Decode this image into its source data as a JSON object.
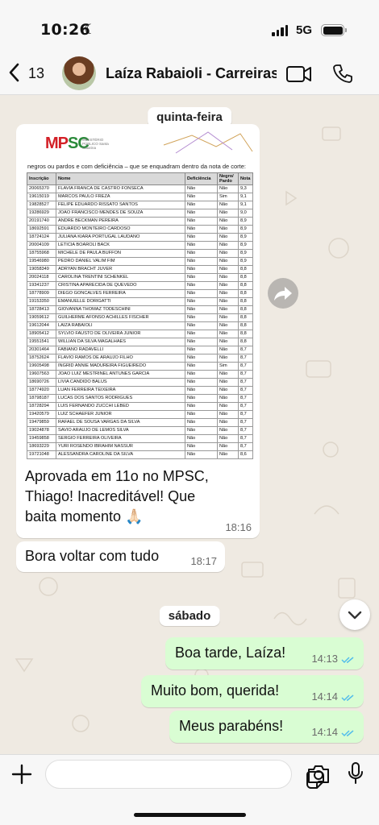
{
  "status_bar": {
    "time": "10:26",
    "network": "5G"
  },
  "header": {
    "back_count": "13",
    "contact_name": "Laíza Rabaioli - Carreiras...",
    "icons": [
      "back-arrow-icon",
      "avatar",
      "video-call-icon",
      "phone-icon"
    ]
  },
  "chat": {
    "day_thursday": "quinta-feira",
    "document": {
      "logo_mp": "MP",
      "logo_sc": "SC",
      "logo_sub": "MINISTÉRIO PÚBLICO Santa Catarina",
      "intro": "negros ou pardos e com deficiência – que se enquadram dentro da nota de corte:",
      "columns": [
        "Inscrição",
        "Nome",
        "Deficiência",
        "Negro/ Pardo",
        "Nota"
      ],
      "rows": [
        [
          "20065370",
          "FLAVIA FRANCA DE CASTRO FONSECA",
          "Não",
          "Não",
          "9,3"
        ],
        [
          "19615019",
          "MARCOS PAULO FREZA",
          "Não",
          "Sim",
          "9,1"
        ],
        [
          "19828527",
          "FELIPE EDUARDO RISSATO SANTOS",
          "Não",
          "Não",
          "9,1"
        ],
        [
          "19286929",
          "JOAO FRANCISCO MENDES DE SOUZA",
          "Não",
          "Não",
          "9,0"
        ],
        [
          "20191740",
          "ANDRE BECKMAN PEREIRA",
          "Não",
          "Não",
          "8,9"
        ],
        [
          "18692591",
          "EDUARDO MONTEIRO CARDOSO",
          "Não",
          "Não",
          "8,9"
        ],
        [
          "18724124",
          "JULIANA KIARA PORTUGAL LAUDANO",
          "Não",
          "Não",
          "8,9"
        ],
        [
          "20004109",
          "LETICIA BOAROLI BACK",
          "Não",
          "Não",
          "8,9"
        ],
        [
          "18755968",
          "MICHELE DE PAULA BUFFON",
          "Não",
          "Não",
          "8,9"
        ],
        [
          "19546980",
          "PEDRO DANIEL VALIM FIM",
          "Não",
          "Não",
          "8,9"
        ],
        [
          "19058349",
          "ADRYAN BRACHT JUVER",
          "Não",
          "Não",
          "8,8"
        ],
        [
          "20024118",
          "CAROLINA TRENTINI SCHENKEL",
          "Não",
          "Não",
          "8,8"
        ],
        [
          "19341237",
          "CRISTINA APARECIDA DE QUEVEDO",
          "Não",
          "Não",
          "8,8"
        ],
        [
          "18778909",
          "DIEGO GONCALVES FERREIRA",
          "Não",
          "Não",
          "8,8"
        ],
        [
          "19153350",
          "EMANUELLE DORIGATTI",
          "Não",
          "Não",
          "8,8"
        ],
        [
          "18728413",
          "GIOVANNA THOMAZ TODESCHINI",
          "Não",
          "Não",
          "8,8"
        ],
        [
          "19059612",
          "GUILHERME AFONSO ACHILLES FISCHER",
          "Não",
          "Não",
          "8,8"
        ],
        [
          "19612044",
          "LAIZA RABAIOLI",
          "Não",
          "Não",
          "8,8"
        ],
        [
          "18905412",
          "SYLVIO FAUSTO DE OLIVEIRA JUNIOR",
          "Não",
          "Não",
          "8,8"
        ],
        [
          "19551541",
          "WILLIAN DA SILVA MAGALHAES",
          "Não",
          "Não",
          "8,8"
        ],
        [
          "20301464",
          "FABIANO RADAVELLI",
          "Não",
          "Não",
          "8,7"
        ],
        [
          "18752624",
          "FLAVIO RAMOS DE ARAUJO FILHO",
          "Não",
          "Não",
          "8,7"
        ],
        [
          "19605498",
          "INGRID ANNIE MADUREIRA FIGUEIREDO",
          "Não",
          "Sim",
          "8,7"
        ],
        [
          "19607563",
          "JOAO LUIZ MESTRINEL ANTUNES GARCIA",
          "Não",
          "Não",
          "8,7"
        ],
        [
          "18690726",
          "LIVIA CANDIDO BALUS",
          "Não",
          "Não",
          "8,7"
        ],
        [
          "18774920",
          "LUAN FERREIRA TEIXEIRA",
          "Não",
          "Não",
          "8,7"
        ],
        [
          "18798187",
          "LUCAS DOS SANTOS RODRIGUES",
          "Não",
          "Não",
          "8,7"
        ],
        [
          "18728294",
          "LUIS FERNANDO ZUCCHI LEBED",
          "Não",
          "Não",
          "8,7"
        ],
        [
          "19420579",
          "LUIZ SCHAEFER JUNIOR",
          "Não",
          "Não",
          "8,7"
        ],
        [
          "19479859",
          "RAFAEL DE SOUSA VARGAS DA SILVA",
          "Não",
          "Não",
          "8,7"
        ],
        [
          "19024878",
          "SAVIO ARAUJO DE LEMOS SILVA",
          "Não",
          "Não",
          "8,7"
        ],
        [
          "19459858",
          "SERGIO FERREIRA OLIVEIRA",
          "Não",
          "Não",
          "8,7"
        ],
        [
          "18693229",
          "YURI ROSENDO IBRAHIM NASSUR",
          "Não",
          "Não",
          "8,7"
        ],
        [
          "19721048",
          "ALESSANDRA CAROLINE DA SILVA",
          "Não",
          "Não",
          "8,6"
        ]
      ]
    },
    "msg1_line1": "Aprovada em 11o no MPSC,",
    "msg1_line2": "Thiago! Inacreditável! Que",
    "msg1_line3": "baita momento 🙏🏻",
    "msg1_time": "18:16",
    "msg2_text": "Bora voltar com tudo",
    "msg2_time": "18:17",
    "day_saturday": "sábado",
    "msg3_text": "Boa tarde, Laíza!",
    "msg3_time": "14:13",
    "msg4_text": "Muito bom, querida!",
    "msg4_time": "14:14",
    "msg5_text": "Meus parabéns!",
    "msg5_time": "14:14",
    "colors": {
      "outgoing_bubble": "#d9fdd3",
      "incoming_bubble": "#ffffff",
      "read_ticks": "#53bdeb",
      "chat_background": "#efeae2"
    }
  },
  "input_bar": {
    "placeholder": "",
    "icons": [
      "plus-icon",
      "sticker-icon",
      "camera-icon",
      "microphone-icon"
    ]
  }
}
